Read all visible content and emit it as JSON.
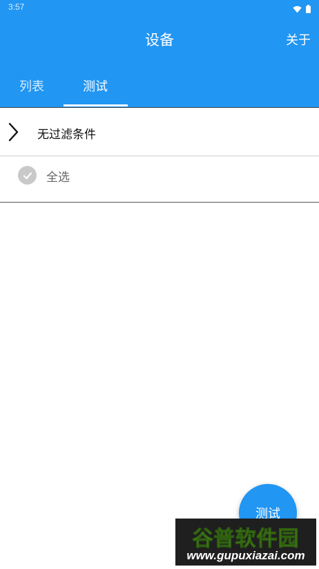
{
  "status_bar": {
    "time": "3:57",
    "icons": [
      "wifi-icon",
      "battery-icon"
    ]
  },
  "app_bar": {
    "title": "设备",
    "about_label": "关于",
    "color": "#2196F3"
  },
  "tabs": [
    {
      "label": "列表",
      "selected": false
    },
    {
      "label": "测试",
      "selected": true
    }
  ],
  "filter": {
    "label": "无过滤条件",
    "icon": "chevron-right-icon"
  },
  "select_all": {
    "label": "全选",
    "icon": "check-circle-icon"
  },
  "fab": {
    "label": "测试"
  },
  "watermark": {
    "line1": "谷普软件园",
    "line2": "www.gupuxiazai.com"
  }
}
